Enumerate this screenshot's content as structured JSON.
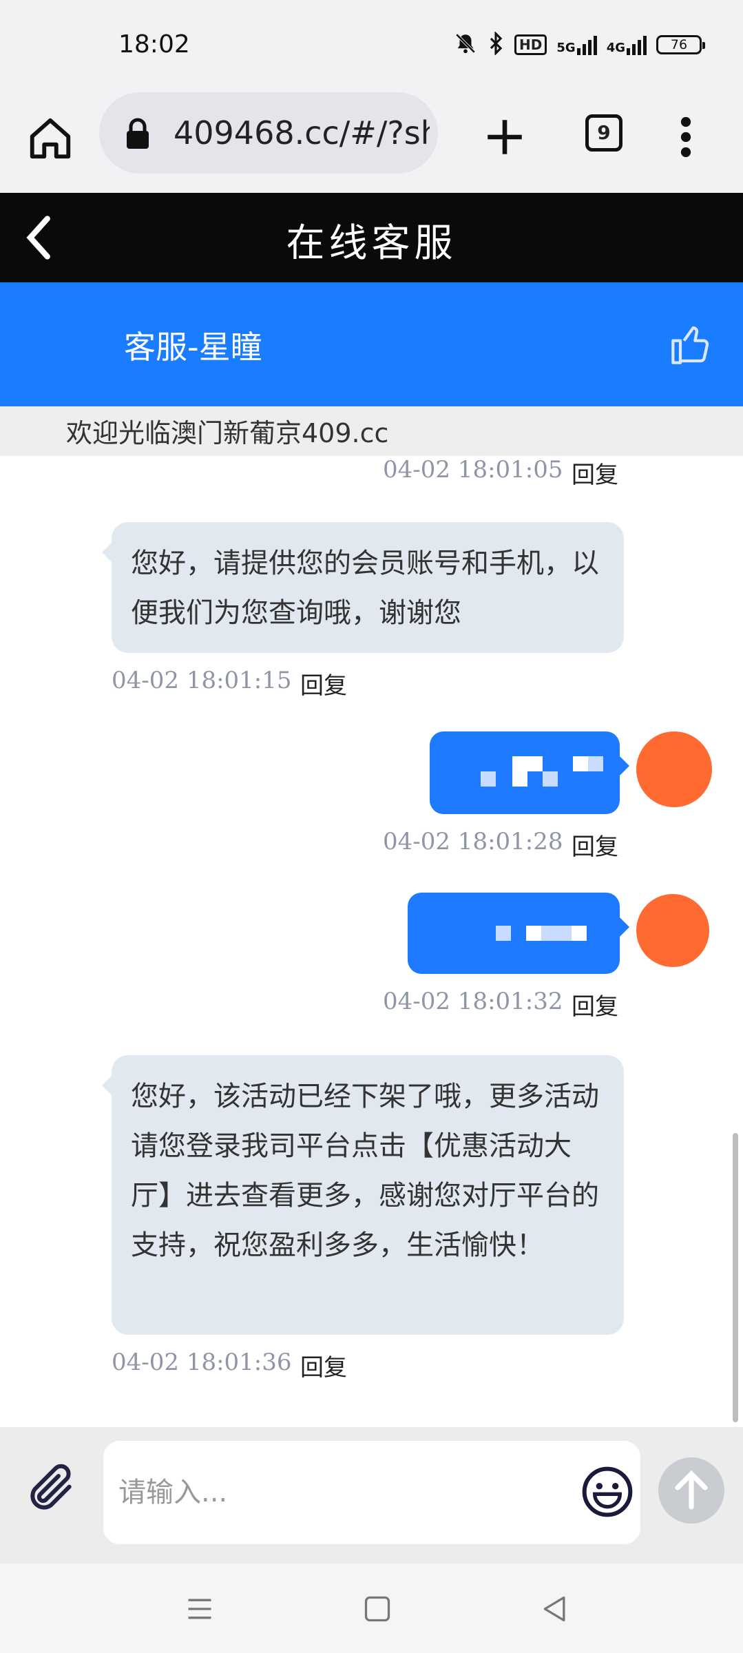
{
  "status_bar": {
    "time": "18:02",
    "icons": [
      "mute-bell-icon",
      "bluetooth-icon",
      "hd-voice-icon",
      "signal-5g-icon",
      "signal-4g-icon",
      "battery-icon"
    ],
    "hd_label": "HD",
    "net1_label": "5G",
    "net2_label": "4G",
    "battery": "76"
  },
  "browser": {
    "url": "409468.cc/#/?sh",
    "tab_count": "9",
    "icons": [
      "home-icon",
      "lock-icon",
      "new-tab-icon",
      "tabs-icon",
      "more-icon"
    ]
  },
  "page": {
    "title": "在线客服",
    "agent_name": "客服-星瞳",
    "notice": "欢迎光临澳门新葡京409.cc"
  },
  "messages": [
    {
      "side": "out",
      "time": "04-02 18:01:05",
      "reply": "回复",
      "partial": true
    },
    {
      "side": "in",
      "text": "您好，请提供您的会员账号和手机，以便我们为您查询哦，谢谢您",
      "time": "04-02 18:01:15",
      "reply": "回复"
    },
    {
      "side": "out",
      "text_hidden": true,
      "time": "04-02 18:01:28",
      "reply": "回复"
    },
    {
      "side": "out",
      "text_hidden": true,
      "time": "04-02 18:01:32",
      "reply": "回复"
    },
    {
      "side": "in",
      "text": "您好，该活动已经下架了哦，更多活动请您登录我司平台点击【优惠活动大厅】进去查看更多，感谢您对厅平台的支持，祝您盈利多多，生活愉快！",
      "time": "04-02 18:01:36",
      "reply": "回复"
    }
  ],
  "input": {
    "placeholder": "请输入..."
  },
  "colors": {
    "header_bg": "#0a0a0a",
    "agent_bar_bg": "#1a7cff",
    "outgoing_bubble": "#1e7bff",
    "incoming_bubble": "#e2e8f0",
    "avatar": "#ff6a30",
    "timestamp": "#8e95a6"
  },
  "nav_icons": [
    "menu-icon",
    "home-square-icon",
    "back-triangle-icon"
  ]
}
